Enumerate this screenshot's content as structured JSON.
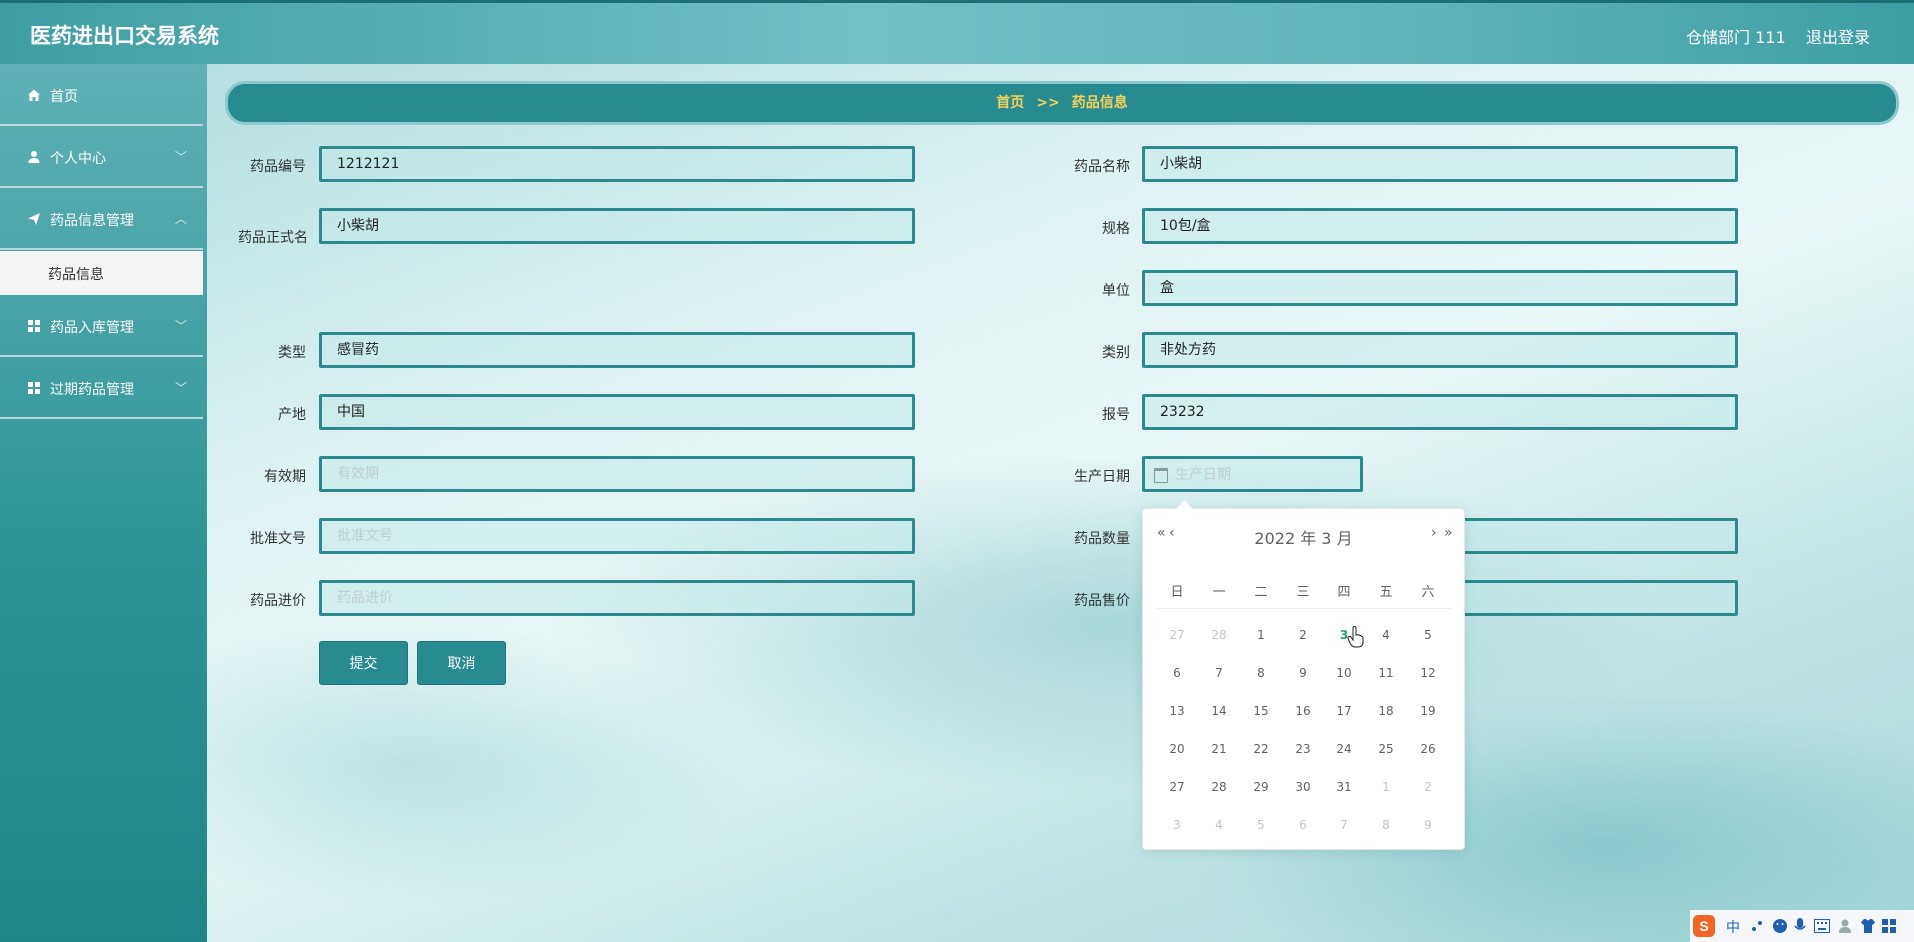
{
  "header": {
    "app_title": "医药进出口交易系统",
    "user": "仓储部门 111",
    "logout": "退出登录"
  },
  "sidebar": {
    "items": [
      {
        "label": "首页",
        "icon": "home-icon",
        "has_chevron": false
      },
      {
        "label": "个人中心",
        "icon": "user-icon",
        "has_chevron": true
      },
      {
        "label": "药品信息管理",
        "icon": "send-icon",
        "has_chevron": true
      },
      {
        "label": "药品入库管理",
        "icon": "grid-icon",
        "has_chevron": true
      },
      {
        "label": "过期药品管理",
        "icon": "grid-icon",
        "has_chevron": true
      }
    ],
    "sub_active": "药品信息"
  },
  "breadcrumb": {
    "home": "首页",
    "separator": ">>",
    "current": "药品信息"
  },
  "form": {
    "left": [
      {
        "label": "药品编号",
        "value": "1212121",
        "placeholder": ""
      },
      {
        "label": "药品正式名",
        "value": "小柴胡",
        "placeholder": ""
      },
      {
        "label": "类型",
        "value": "感冒药",
        "placeholder": ""
      },
      {
        "label": "产地",
        "value": "中国",
        "placeholder": ""
      },
      {
        "label": "有效期",
        "value": "",
        "placeholder": "有效期"
      },
      {
        "label": "批准文号",
        "value": "",
        "placeholder": "批准文号"
      },
      {
        "label": "药品进价",
        "value": "",
        "placeholder": "药品进价"
      }
    ],
    "right": [
      {
        "label": "药品名称",
        "value": "小柴胡",
        "placeholder": ""
      },
      {
        "label": "规格",
        "value": "10包/盒",
        "placeholder": ""
      },
      {
        "label": "单位",
        "value": "盒",
        "placeholder": ""
      },
      {
        "label": "类别",
        "value": "非处方药",
        "placeholder": ""
      },
      {
        "label": "报号",
        "value": "23232",
        "placeholder": ""
      },
      {
        "label": "生产日期",
        "value": "",
        "placeholder": "生产日期"
      },
      {
        "label": "药品数量",
        "value": "",
        "placeholder": ""
      },
      {
        "label": "药品售价",
        "value": "",
        "placeholder": ""
      }
    ],
    "submit": "提交",
    "cancel": "取消"
  },
  "datepicker": {
    "title": "2022 年  3 月",
    "prev_year": "«",
    "prev_month": "‹",
    "next_month": "›",
    "next_year": "»",
    "weekdays": [
      "日",
      "一",
      "二",
      "三",
      "四",
      "五",
      "六"
    ],
    "weeks": [
      [
        "27",
        "28",
        "1",
        "2",
        "3",
        "4",
        "5"
      ],
      [
        "6",
        "7",
        "8",
        "9",
        "10",
        "11",
        "12"
      ],
      [
        "13",
        "14",
        "15",
        "16",
        "17",
        "18",
        "19"
      ],
      [
        "20",
        "21",
        "22",
        "23",
        "24",
        "25",
        "26"
      ],
      [
        "27",
        "28",
        "29",
        "30",
        "31",
        "1",
        "2"
      ],
      [
        "3",
        "4",
        "5",
        "6",
        "7",
        "8",
        "9"
      ]
    ],
    "today": "3"
  },
  "tray": {
    "ime": "中"
  }
}
